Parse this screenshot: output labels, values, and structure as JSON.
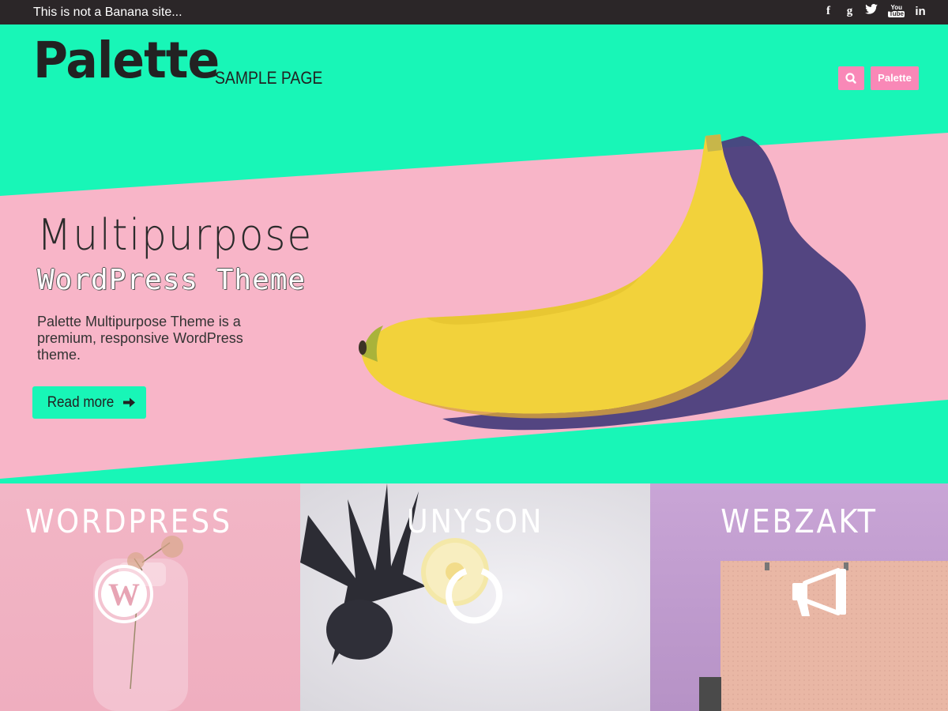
{
  "topbar": {
    "tagline": "This is not a Banana site...",
    "social": [
      {
        "icon": "facebook-icon",
        "glyph": "f"
      },
      {
        "icon": "google-plus-icon",
        "glyph": "g"
      },
      {
        "icon": "twitter-icon",
        "glyph": "🐦"
      },
      {
        "icon": "youtube-icon",
        "glyph_top": "You",
        "glyph_bottom": "Tube"
      },
      {
        "icon": "linkedin-icon",
        "glyph": "in"
      }
    ]
  },
  "header": {
    "logo": "Palette",
    "nav_sample": "SAMPLE PAGE",
    "palette_button": "Palette"
  },
  "hero": {
    "title": "Multipurpose",
    "subtitle": "WordPress Theme",
    "description": "Palette Multipurpose Theme is a premium, responsive WordPress theme.",
    "read_more": "Read more"
  },
  "panels": [
    {
      "title": "WORDPRESS",
      "icon": "wordpress-icon"
    },
    {
      "title": "UNYSON",
      "icon": "unyson-icon"
    },
    {
      "title": "WEBZAKT",
      "icon": "megaphone-icon"
    }
  ],
  "colors": {
    "accent": "#18f6b7",
    "pink": "#f8b5c8",
    "button_pink": "#f988b7",
    "topbar": "#2b2628"
  }
}
